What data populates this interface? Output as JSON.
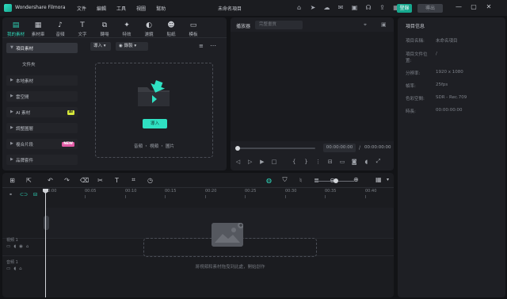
{
  "app": {
    "name": "Wondershare Filmora",
    "project_title": "未命名項目",
    "menu": [
      "文件",
      "編輯",
      "工具",
      "視圖",
      "幫助"
    ],
    "login_label": "登錄",
    "export_label": "導出",
    "top_icons": [
      "gift-icon",
      "send-icon",
      "cloud-icon",
      "mail-icon",
      "image-icon",
      "headset-icon",
      "upload-icon",
      "layout-icon"
    ],
    "accent_color": "#2fe0c2"
  },
  "media_tabs": [
    {
      "label": "我的素材",
      "icon": "folder-icon",
      "active": true
    },
    {
      "label": "素材庫",
      "icon": "library-icon"
    },
    {
      "label": "音頻",
      "icon": "music-icon"
    },
    {
      "label": "文字",
      "icon": "text-icon"
    },
    {
      "label": "轉場",
      "icon": "transition-icon"
    },
    {
      "label": "特效",
      "icon": "effects-icon"
    },
    {
      "label": "濾鏡",
      "icon": "filter-icon"
    },
    {
      "label": "貼紙",
      "icon": "sticker-icon"
    },
    {
      "label": "模板",
      "icon": "template-icon"
    }
  ],
  "side_nav": [
    {
      "label": "項目素材",
      "active": true
    },
    {
      "label": "文件夾",
      "sub": true
    },
    {
      "label": "本地素材"
    },
    {
      "label": "雲空間"
    },
    {
      "label": "AI 素材",
      "badge": "AI"
    },
    {
      "label": "調整圖層"
    },
    {
      "label": "複合片段",
      "badge": "NEW"
    },
    {
      "label": "品牌套件"
    }
  ],
  "media_toolbar": {
    "import_label": "導入",
    "record_label": "錄製"
  },
  "dropzone": {
    "button_label": "導入",
    "hint": "音頻 ・ 視頻 ・ 圖片"
  },
  "preview": {
    "label": "播放器",
    "quality_placeholder": "完整畫質",
    "time_current": "00:00:00:00",
    "time_separator": "/",
    "time_total": "00:00:00:00"
  },
  "properties": {
    "title": "項目信息",
    "rows": [
      {
        "key": "項目名稱:",
        "value": "未命名項目"
      },
      {
        "key": "項目文件位置:",
        "value": "/"
      },
      {
        "key": "分辨率:",
        "value": "1920 x 1080"
      },
      {
        "key": "幀率:",
        "value": "25fps"
      },
      {
        "key": "色彩空間:",
        "value": "SDR - Rec.709"
      },
      {
        "key": "時長:",
        "value": "00:00:00:00"
      }
    ]
  },
  "timeline": {
    "ruler": [
      "00:00",
      "00:05",
      "00:10",
      "00:15",
      "00:20",
      "00:25",
      "00:30",
      "00:35",
      "00:40"
    ],
    "video_track_label": "視頻 1",
    "audio_track_label": "音頻 1",
    "drop_hint": "將視頻和素材拖曳到此處，開始創作"
  }
}
